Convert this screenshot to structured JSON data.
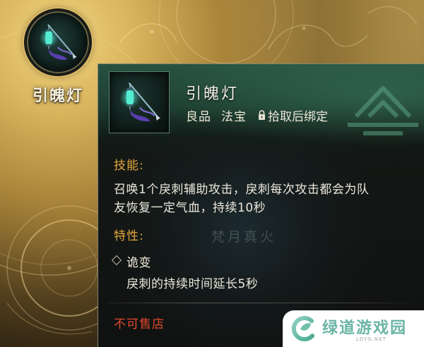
{
  "item": {
    "name": "引魄灯",
    "icon": "lantern-icon"
  },
  "tooltip": {
    "title": "引魄灯",
    "quality": "良品",
    "category": "法宝",
    "bind_icon": "lock-icon",
    "bind_text": "拾取后绑定",
    "skill": {
      "heading": "技能:",
      "lines": [
        "召唤1个戾刺辅助攻击，戾刺每次攻击都会为队",
        "友恢复一定气血，持续10秒"
      ]
    },
    "background_text": "梵月真火",
    "traits": {
      "heading": "特性:",
      "items": [
        {
          "bullet_icon": "diamond-icon",
          "name": "诡变",
          "description": "戾刺的持续时间延长5秒"
        }
      ]
    },
    "sell_note": "不可售店"
  },
  "watermark": {
    "logo_icon": "site-logo-icon",
    "name": "绿道游戏园",
    "domain": "LDYG.NET"
  },
  "colors": {
    "heading": "#e3a63b",
    "sell_note": "#e24a2c",
    "body_text": "#ece8dc",
    "header_green": "#285442",
    "lantern_glow": "#55ecd4",
    "watermark_text": "#6ab5a4"
  }
}
